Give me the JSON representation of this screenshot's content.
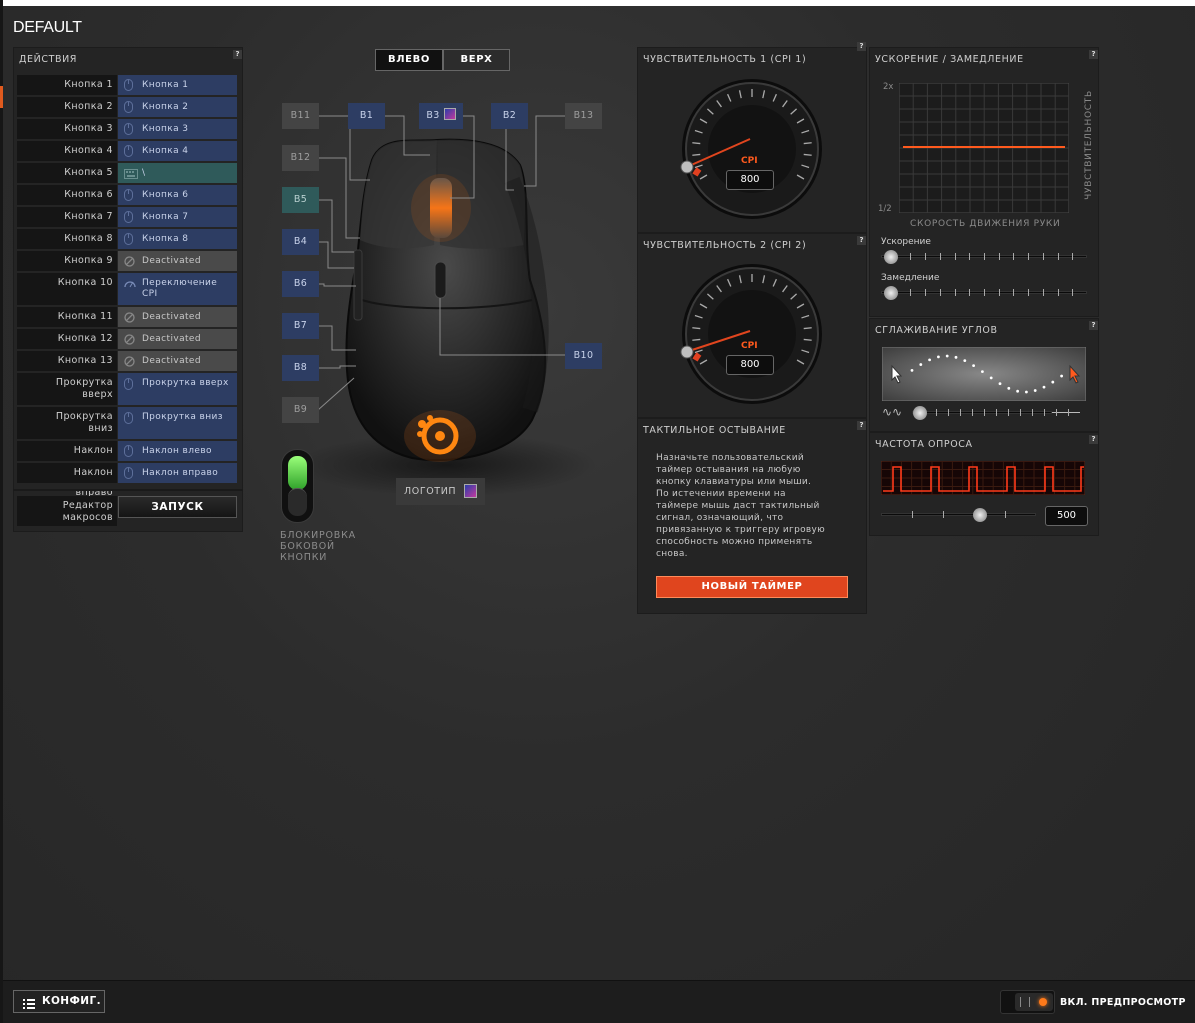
{
  "profile": {
    "title": "DEFAULT"
  },
  "actions": {
    "title": "ДЕЙСТВИЯ",
    "help": "?",
    "rows": [
      {
        "label": "Кнопка 1",
        "value": "Кнопка 1",
        "kind": "mouse"
      },
      {
        "label": "Кнопка 2",
        "value": "Кнопка 2",
        "kind": "mouse"
      },
      {
        "label": "Кнопка 3",
        "value": "Кнопка 3",
        "kind": "mouse"
      },
      {
        "label": "Кнопка 4",
        "value": "Кнопка 4",
        "kind": "mouse"
      },
      {
        "label": "Кнопка 5",
        "value": "\\",
        "kind": "key"
      },
      {
        "label": "Кнопка 6",
        "value": "Кнопка 6",
        "kind": "mouse"
      },
      {
        "label": "Кнопка 7",
        "value": "Кнопка 7",
        "kind": "mouse"
      },
      {
        "label": "Кнопка 8",
        "value": "Кнопка 8",
        "kind": "mouse"
      },
      {
        "label": "Кнопка 9",
        "value": "Deactivated",
        "kind": "off"
      },
      {
        "label": "Кнопка 10",
        "value": "Переключение CPI",
        "kind": "cpi"
      },
      {
        "label": "Кнопка 11",
        "value": "Deactivated",
        "kind": "off"
      },
      {
        "label": "Кнопка 12",
        "value": "Deactivated",
        "kind": "off"
      },
      {
        "label": "Кнопка 13",
        "value": "Deactivated",
        "kind": "off"
      },
      {
        "label": "Прокрутка вверх",
        "value": "Прокрутка вверх",
        "kind": "mouse"
      },
      {
        "label": "Прокрутка вниз",
        "value": "Прокрутка вниз",
        "kind": "mouse"
      },
      {
        "label": "Наклон влево",
        "value": "Наклон влево",
        "kind": "mouse"
      },
      {
        "label": "Наклон вправо",
        "value": "Наклон вправо",
        "kind": "mouse"
      }
    ],
    "macro_label": "Редактор макросов",
    "macro_button": "ЗАПУСК"
  },
  "mouse_view": {
    "view_left": "ВЛЕВО",
    "view_top": "ВЕРХ",
    "buttons": [
      {
        "id": "B11",
        "style": "gray"
      },
      {
        "id": "B1",
        "style": "blue"
      },
      {
        "id": "B3",
        "style": "blue"
      },
      {
        "id": "B2",
        "style": "blue"
      },
      {
        "id": "B13",
        "style": "gray"
      },
      {
        "id": "B12",
        "style": "gray"
      },
      {
        "id": "B5",
        "style": "teal"
      },
      {
        "id": "B4",
        "style": "blue"
      },
      {
        "id": "B6",
        "style": "blue"
      },
      {
        "id": "B7",
        "style": "blue"
      },
      {
        "id": "B8",
        "style": "blue"
      },
      {
        "id": "B9",
        "style": "gray"
      },
      {
        "id": "B10",
        "style": "blue"
      }
    ],
    "logo_label": "ЛОГОТИП",
    "side_lock_label": "БЛОКИРОВКА БОКОВОЙ КНОПКИ",
    "side_lock_line1": "БЛОКИРОВКА",
    "side_lock_line2": "БОКОВОЙ",
    "side_lock_line3": "КНОПКИ",
    "side_lock_on": true,
    "accent_color": "#ff7a1a"
  },
  "sensitivity1": {
    "title": "ЧУВСТВИТЕЛЬНОСТЬ 1 (CPI 1)",
    "unit": "CPI",
    "value": "800",
    "help": "?"
  },
  "sensitivity2": {
    "title": "ЧУВСТВИТЕЛЬНОСТЬ 2 (CPI 2)",
    "unit": "CPI",
    "value": "800",
    "help": "?"
  },
  "tactile": {
    "title": "ТАКТИЛЬНОЕ ОСТЫВАНИЕ",
    "help": "?",
    "lines": [
      "Назначьте пользовательский",
      "таймер остывания на любую",
      "кнопку клавиатуры или мыши.",
      "По истечении времени на",
      "таймере мышь даст тактильный",
      "сигнал, означающий, что",
      "привязанную к триггеру игровую",
      "способность можно применять",
      "снова."
    ],
    "button": "НОВЫЙ ТАЙМЕР"
  },
  "acceleration": {
    "title": "УСКОРЕНИЕ / ЗАМЕДЛЕНИЕ",
    "help": "?",
    "y_top": "2x",
    "y_bottom": "1/2",
    "x_label": "СКОРОСТЬ ДВИЖЕНИЯ РУКИ",
    "y_label": "ЧУВСТВИТЕЛЬНОСТЬ",
    "accel_label": "Ускорение",
    "decel_label": "Замедление",
    "accel_value": 0,
    "decel_value": 0,
    "line_color": "#ff5a1e"
  },
  "angle_snapping": {
    "title": "СГЛАЖИВАНИЕ УГЛОВ",
    "help": "?",
    "value": 0.05
  },
  "polling": {
    "title": "ЧАСТОТА ОПРОСА",
    "help": "?",
    "value": "500",
    "slider_fraction": 0.66
  },
  "footer": {
    "config_button": "КОНФИГ.",
    "preview_label": "ВКЛ. ПРЕДПРОСМОТР"
  }
}
